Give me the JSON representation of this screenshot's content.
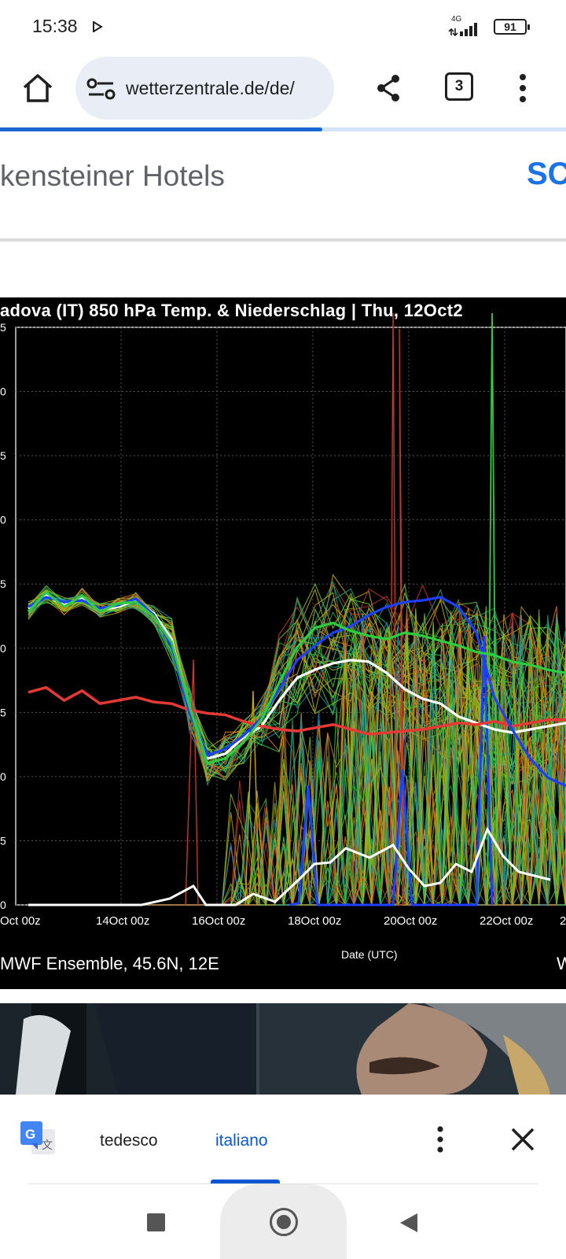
{
  "status_bar": {
    "time": "15:38",
    "network": "4G",
    "battery": "91"
  },
  "browser": {
    "url": "wetterzentrale.de/de/",
    "tab_count": "3",
    "load_progress": 0.57
  },
  "ad": {
    "text": "kensteiner Hotels",
    "cta": "SC"
  },
  "chart_data": {
    "type": "line",
    "title": "adova  (IT)  850 hPa Temp. & Niederschlag | Thu, 12Oct2",
    "xlabel": "Date (UTC)",
    "x_ticks": [
      "Oct 00z",
      "14Oct 00z",
      "16Oct 00z",
      "18Oct 00z",
      "20Oct 00z",
      "22Oct 00z",
      "2"
    ],
    "y_ticks": [
      "5",
      "0",
      "5",
      "0",
      "5",
      "0",
      "5",
      "0",
      "5",
      "0"
    ],
    "footer_left": "MWF Ensemble, 45.6N, 12E",
    "footer_right": "W",
    "series": [
      {
        "color": "#ffffff",
        "values": [
          13.5,
          14.3,
          13.7,
          14.2,
          13.4,
          13.6,
          14.0,
          13.2,
          11.6,
          7.2,
          4.2,
          4.5,
          5.5,
          6.2,
          7.8,
          9.2,
          9.7,
          10.1,
          10.3,
          10.2,
          9.5,
          8.5,
          7.9,
          7.6,
          6.8,
          6.4,
          6.0,
          5.8,
          6.0,
          6.2,
          6.4
        ]
      },
      {
        "color": "#e53935",
        "values": [
          8.3,
          8.6,
          7.8,
          8.4,
          7.6,
          7.8,
          8.0,
          7.7,
          7.6,
          7.2,
          7.0,
          6.9,
          6.5,
          6.2,
          6.0,
          5.9,
          6.1,
          6.3,
          6.0,
          5.7,
          5.8,
          5.9,
          6.0,
          6.2,
          6.4,
          6.3,
          6.5,
          6.2,
          6.4,
          6.6,
          6.6
        ]
      },
      {
        "color": "#1f3fff",
        "values": [
          13.6,
          14.2,
          13.9,
          14.0,
          13.5,
          13.7,
          14.1,
          13.1,
          11.2,
          7.0,
          4.4,
          4.8,
          5.6,
          6.7,
          8.5,
          10.3,
          11.2,
          12.0,
          12.4,
          13.1,
          13.6,
          13.9,
          14.0,
          14.2,
          13.6,
          12.0,
          8.0,
          6.0,
          4.2,
          3.0,
          2.5
        ]
      },
      {
        "color": "#2ecc40",
        "values": [
          13.3,
          14.5,
          13.6,
          14.3,
          13.3,
          13.8,
          13.9,
          13.0,
          11.4,
          7.4,
          3.9,
          4.2,
          5.2,
          6.6,
          8.9,
          11.1,
          12.3,
          12.6,
          12.1,
          11.8,
          11.6,
          12.0,
          11.8,
          11.5,
          11.2,
          10.8,
          10.6,
          10.2,
          10.0,
          9.7,
          9.5
        ]
      }
    ]
  },
  "translate_bar": {
    "source_lang": "tedesco",
    "target_lang": "italiano"
  }
}
